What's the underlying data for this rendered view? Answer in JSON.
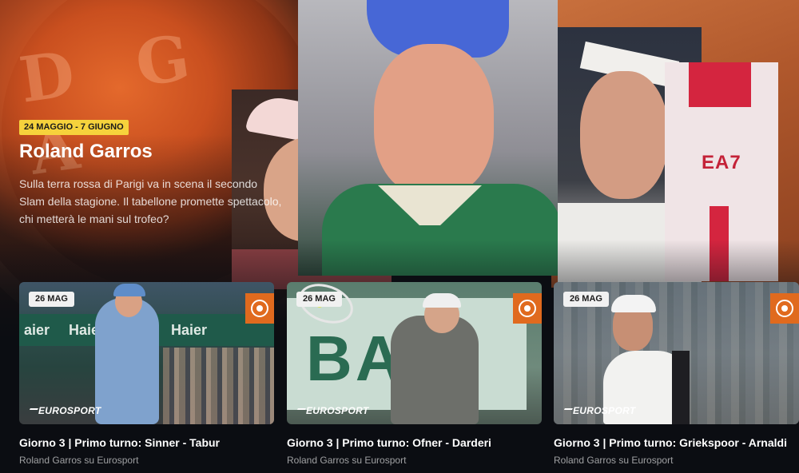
{
  "hero": {
    "date_range": "24 MAGGIO - 7 GIUGNO",
    "title": "Roland Garros",
    "description": "Sulla terra rossa di Parigi va in scena il secondo Slam della stagione. Il tabellone promette spettacolo, chi metterà le mani sul trofeo?",
    "seal_letters": "D G A",
    "shirt_logo": "EA7"
  },
  "cards": [
    {
      "date": "26 MAG",
      "title": "Giorno 3 | Primo turno: Sinner - Tabur",
      "subtitle": "Roland Garros su Eurosport",
      "channel_logo": "EUROSPORT",
      "board_text_1": "aier",
      "board_text_2": "Haie",
      "board_text_3": "Haier"
    },
    {
      "date": "26 MAG",
      "title": "Giorno 3 | Primo turno: Ofner - Darderi",
      "subtitle": "Roland Garros su Eurosport",
      "channel_logo": "EUROSPORT",
      "wall_text": "BAS"
    },
    {
      "date": "26 MAG",
      "title": "Giorno 3 | Primo turno: Griekspoor - Arnaldi",
      "subtitle": "Roland Garros su Eurosport",
      "channel_logo": "EUROSPORT"
    }
  ],
  "colors": {
    "date_badge_bg": "#f6d23c",
    "rg_logo_bg": "#e06a1e",
    "page_bg": "#0b0d12"
  }
}
